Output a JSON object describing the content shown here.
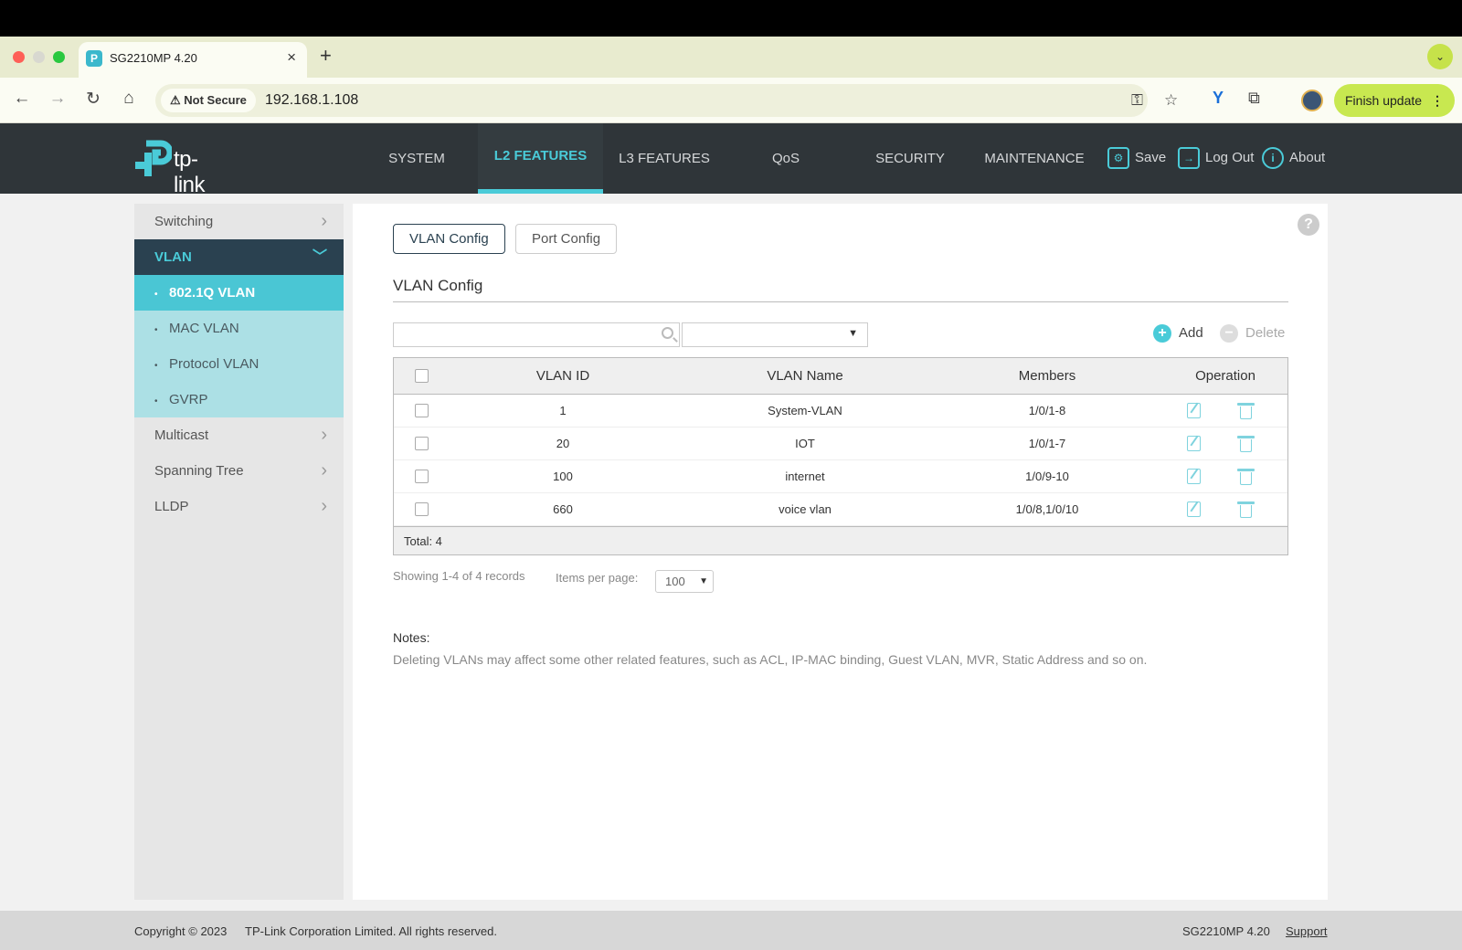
{
  "browser": {
    "tab_title": "SG2210MP 4.20",
    "tab_favicon": "tp-link-favicon",
    "tab_close": "×",
    "new_tab": "+",
    "tab_menu": "⌄",
    "security_label": "Not Secure",
    "url": "192.168.1.108",
    "finish_update": "Finish update",
    "menu_dots": "⋮",
    "icons": [
      "back-icon",
      "forward-icon",
      "reload-icon",
      "home-icon",
      "warning-icon",
      "key-icon",
      "star-icon",
      "extension-y-icon",
      "puzzle-icon",
      "avatar"
    ]
  },
  "header": {
    "logo_text": "tp-link",
    "nav": [
      "SYSTEM",
      "L2 FEATURES",
      "L3 FEATURES",
      "QoS",
      "SECURITY",
      "MAINTENANCE"
    ],
    "active_nav": "L2 FEATURES",
    "actions": {
      "save": "Save",
      "logout": "Log Out",
      "about": "About"
    },
    "accent": "#4acbd8"
  },
  "sidebar": {
    "items": [
      "Switching",
      "VLAN",
      "Multicast",
      "Spanning Tree",
      "LLDP"
    ],
    "vlan_sub": [
      "802.1Q VLAN",
      "MAC VLAN",
      "Protocol VLAN",
      "GVRP"
    ],
    "active_sub": "802.1Q VLAN"
  },
  "content": {
    "tabs": [
      "VLAN Config",
      "Port Config"
    ],
    "active_tab": "VLAN Config",
    "section_title": "VLAN Config",
    "search_value": "",
    "filter_value": "",
    "add_label": "Add",
    "delete_label": "Delete",
    "table": {
      "headers": [
        "VLAN ID",
        "VLAN Name",
        "Members",
        "Operation"
      ],
      "rows": [
        {
          "id": "1",
          "name": "System-VLAN",
          "members": "1/0/1-8"
        },
        {
          "id": "20",
          "name": "IOT",
          "members": "1/0/1-7"
        },
        {
          "id": "100",
          "name": "internet",
          "members": "1/0/9-10"
        },
        {
          "id": "660",
          "name": "voice vlan",
          "members": "1/0/8,1/0/10"
        }
      ],
      "total": "Total: 4"
    },
    "showing": "Showing 1-4 of 4 records",
    "items_per_page_label": "Items per page:",
    "items_per_page": "100",
    "notes_title": "Notes:",
    "notes_body": "Deleting VLANs may affect some other related features, such as ACL, IP-MAC binding, Guest VLAN, MVR, Static Address and so on."
  },
  "footer": {
    "copyright": "Copyright © 2023",
    "company": "TP-Link Corporation Limited. All rights reserved.",
    "model": "SG2210MP 4.20",
    "support": "Support"
  }
}
